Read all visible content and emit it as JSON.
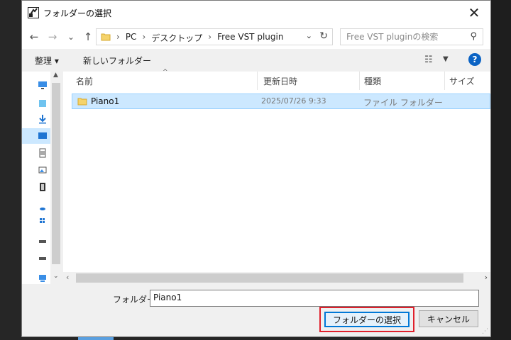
{
  "window": {
    "title": "フォルダーの選択",
    "close": "✕"
  },
  "nav": {
    "back": "←",
    "forward": "→",
    "recent": "⌄",
    "up": "↑",
    "breadcrumb": [
      "PC",
      "デスクトップ",
      "Free VST plugin"
    ],
    "separator": "›",
    "dropdown": "⌄",
    "refresh": "↻"
  },
  "search": {
    "placeholder": "Free VST pluginの検索",
    "icon": "⚲"
  },
  "toolbar": {
    "organize": "整理 ▾",
    "new_folder": "新しいフォルダー",
    "view": "☷",
    "view_dd": "▼",
    "help": "?"
  },
  "columns": {
    "name": "名前",
    "modified": "更新日時",
    "type": "種類",
    "size": "サイズ",
    "sort_indicator": "^"
  },
  "rows": [
    {
      "name": "Piano1",
      "modified": "2025/07/26 9:33",
      "type": "ファイル フォルダー",
      "size": ""
    }
  ],
  "scroll": {
    "left": "‹",
    "right": "›",
    "up": "▲",
    "down": "⌄"
  },
  "bottom": {
    "folder_label": "フォルダー:",
    "folder_value": "Piano1",
    "select_button": "フォルダーの選択",
    "cancel_button": "キャンセル"
  },
  "colors": {
    "highlight": "#e0202b",
    "selection": "#cce8ff",
    "accent": "#0078d7"
  }
}
